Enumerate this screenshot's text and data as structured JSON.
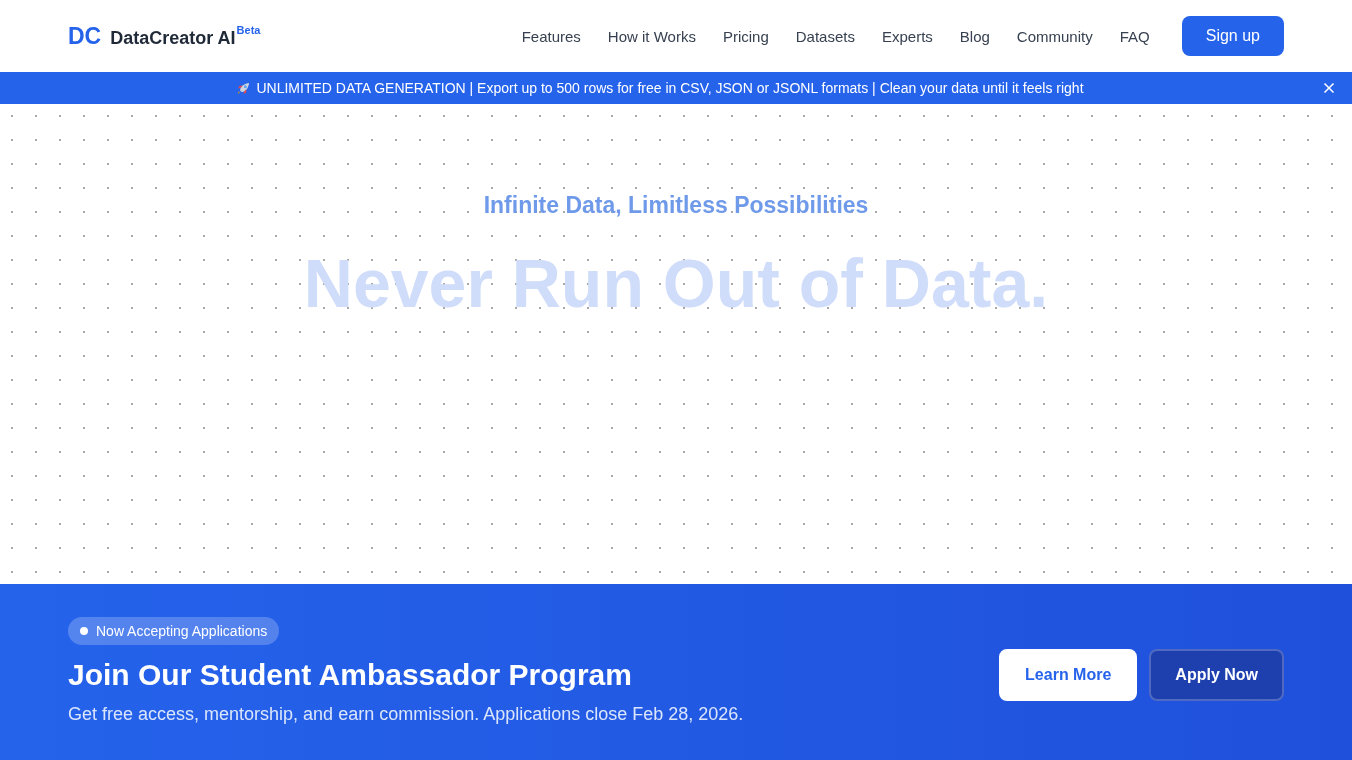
{
  "header": {
    "logo": {
      "mark": "DC",
      "name": "DataCreator AI",
      "badge": "Beta"
    },
    "nav": [
      "Features",
      "How it Works",
      "Pricing",
      "Datasets",
      "Experts",
      "Blog",
      "Community",
      "FAQ"
    ],
    "cta": "Sign up"
  },
  "announcement": {
    "text": "UNLIMITED DATA GENERATION | Export up to 500 rows for free in CSV, JSON or JSONL formats | Clean your data until it feels right"
  },
  "hero": {
    "tagline": "Infinite Data, Limitless Possibilities",
    "headline": "Never Run Out of Data."
  },
  "ambassador": {
    "badge": "Now Accepting Applications",
    "title": "Join Our Student Ambassador Program",
    "description": "Get free access, mentorship, and earn commission. Applications close Feb 28, 2026.",
    "buttons": [
      {
        "label": "Learn More",
        "kind": "primary"
      },
      {
        "label": "Apply Now",
        "kind": "secondary"
      }
    ]
  }
}
